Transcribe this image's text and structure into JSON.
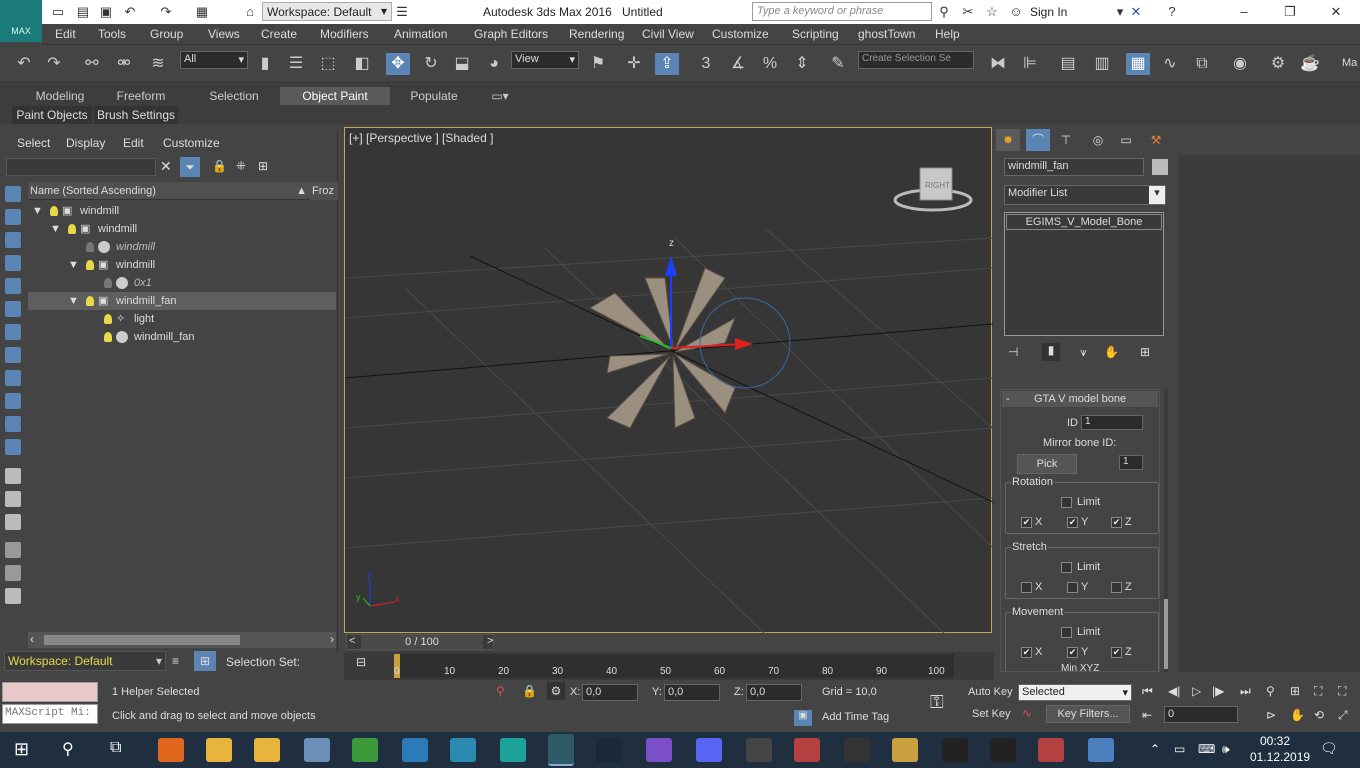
{
  "title": {
    "app": "Autodesk 3ds Max 2016",
    "doc": "Untitled",
    "workspace": "Workspace: Default",
    "search_placeholder": "Type a keyword or phrase",
    "sign_in": "Sign In",
    "logo": "MAX"
  },
  "menu": [
    "Edit",
    "Tools",
    "Group",
    "Views",
    "Create",
    "Modifiers",
    "Animation",
    "Graph Editors",
    "Rendering",
    "Civil View",
    "Customize",
    "Scripting",
    "ghostTown",
    "Help"
  ],
  "toolbar": {
    "filter": "All",
    "ref_coord": "View",
    "selset_placeholder": "Create Selection Se",
    "ma": "Ma",
    "snap": "3"
  },
  "ribbon": {
    "tabs": [
      "Modeling",
      "Freeform",
      "Selection",
      "Object Paint",
      "Populate"
    ],
    "active": "Object Paint",
    "subtabs": [
      "Paint Objects",
      "Brush Settings"
    ]
  },
  "explorer": {
    "menus": [
      "Select",
      "Display",
      "Edit",
      "Customize"
    ],
    "col_name": "Name (Sorted Ascending)",
    "col_frozen": "Froz",
    "rows": [
      "windmill",
      "windmill",
      "windmill",
      "windmill",
      "0x1",
      "windmill_fan",
      "light",
      "windmill_fan"
    ],
    "workspace": "Workspace: Default",
    "selset": "Selection Set:"
  },
  "viewport": {
    "label": "[+] [Perspective ] [Shaded ]",
    "cube": "RIGHT",
    "axis_z": "z",
    "axis_y": "y",
    "axis_x": "x"
  },
  "modify": {
    "name": "windmill_fan",
    "modifier_list": "Modifier List",
    "stack": [
      "EGIMS_V_Model_Bone"
    ],
    "rollout": "GTA V model bone",
    "rollout_toggle": "-",
    "id_label": "ID",
    "id": "1",
    "mirror_label": "Mirror bone ID:",
    "pick": "Pick",
    "mirror_val": "1",
    "rotation": "Rotation",
    "stretch": "Stretch",
    "movement": "Movement",
    "limit": "Limit",
    "x": "X",
    "y": "Y",
    "z": "Z",
    "minxyz": "Min XYZ"
  },
  "timeline": {
    "frame": "0 / 100",
    "ticks": [
      "0",
      "10",
      "20",
      "30",
      "40",
      "50",
      "60",
      "70",
      "80",
      "90",
      "100"
    ]
  },
  "status": {
    "selected": "1 Helper Selected",
    "prompt": "Click and drag to select and move objects",
    "script": "MAXScript Mi:",
    "x_label": "X:",
    "y_label": "Y:",
    "z_label": "Z:",
    "x": "0,0",
    "y": "0,0",
    "z": "0,0",
    "grid": "Grid = 10,0",
    "add_time_tag": "Add Time Tag",
    "auto_key": "Auto Key",
    "set_key": "Set Key",
    "selected_mode": "Selected",
    "key_filters": "Key Filters...",
    "frame": "0"
  },
  "taskbar": {
    "time": "00:32",
    "date": "01.12.2019"
  }
}
